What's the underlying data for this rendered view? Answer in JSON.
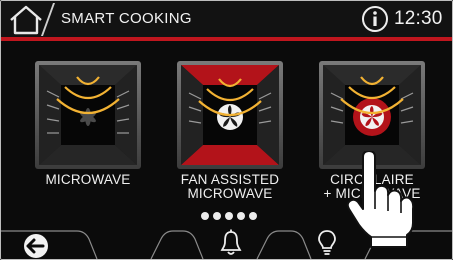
{
  "header": {
    "title": "SMART COOKING",
    "time": "12:30",
    "home_icon": "home-icon",
    "info_icon": "info-icon"
  },
  "modes": [
    {
      "label_line1": "MICROWAVE",
      "label_line2": "",
      "icon": "microwave-oven-icon",
      "selected": false
    },
    {
      "label_line1": "FAN ASSISTED",
      "label_line2": "MICROWAVE",
      "icon": "fan-assisted-microwave-oven-icon",
      "selected": false
    },
    {
      "label_line1": "CIRCULAIRE",
      "label_line2": "+ MICROWAVE",
      "icon": "circulaire-microwave-oven-icon",
      "selected": true
    }
  ],
  "pager": {
    "count": 5,
    "active": 0
  },
  "bottom_bar": {
    "back_icon": "back-arrow-icon",
    "bell_icon": "bell-icon",
    "bulb_icon": "light-bulb-icon"
  },
  "colors": {
    "accent": "#c0161e",
    "heat": "#f2b233",
    "text": "#f2f2f2",
    "background": "#0b0b0b"
  }
}
